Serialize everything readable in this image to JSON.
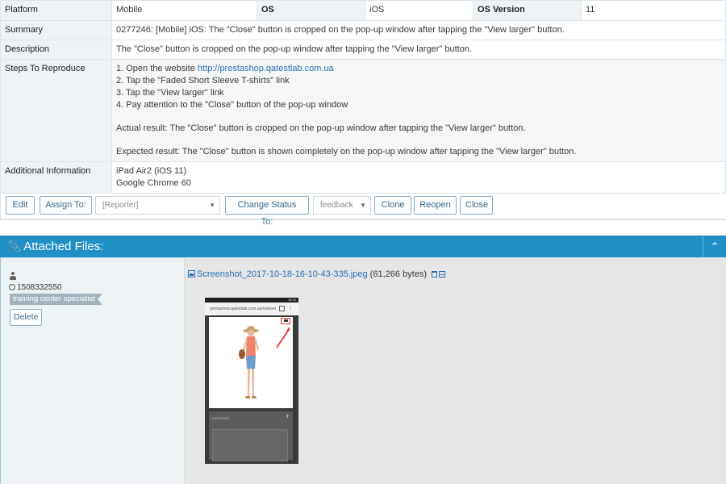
{
  "issue": {
    "platform_label": "Platform",
    "platform_value": "Mobile",
    "os_label": "OS",
    "os_value": "iOS",
    "os_version_label": "OS Version",
    "os_version_value": "11",
    "summary_label": "Summary",
    "summary_value": "0277246: [Mobile] iOS: The \"Close\" button is cropped on the pop-up window after tapping the \"View larger\" button.",
    "description_label": "Description",
    "description_value": "The \"Close\" button is cropped on the pop-up window after tapping the \"View larger\" button.",
    "steps_label": "Steps To Reproduce",
    "steps": {
      "step1_prefix": "1. Open the website ",
      "step1_link": "http://prestashop.qatestlab.com.ua",
      "step2": "2. Tap the \"Faded Short Sleeve T-shirts\" link",
      "step3": "3. Tap the \"View larger\" link",
      "step4": "4. Pay attention to the \"Close\" button of the pop-up window",
      "actual": "Actual result: The \"Close\" button is cropped on the pop-up window after tapping the \"View larger\" button.",
      "expected": "Expected result: The \"Close\" button is shown completely on the pop-up window after tapping the \"View larger\" button."
    },
    "additional_label": "Additional Information",
    "additional_line1": "iPad Air2 (iOS 11)",
    "additional_line2": "Google Chrome 60"
  },
  "actions": {
    "edit": "Edit",
    "assign_to": "Assign To:",
    "assign_select": "[Reporter]",
    "change_status": "Change Status To:",
    "status_select": "feedback",
    "clone": "Clone",
    "reopen": "Reopen",
    "close": "Close"
  },
  "attachments": {
    "header": "Attached Files:",
    "user_id": "1508332550",
    "role": "training center specialist",
    "delete": "Delete",
    "file_name": "Screenshot_2017-10-18-16-10-43-335.jpeg",
    "file_size": "(61,266 bytes)",
    "thumb": {
      "status_time": "16:10",
      "url": "prestashop.qatestlab.com.ua/ru/wom",
      "caption": "Faded Short Sleeve T-shirts",
      "section_label": "MAKEPOPE"
    }
  },
  "icons": {
    "attach": "paperclip-icon",
    "collapse": "chevron-up-icon",
    "user": "user-icon",
    "clock": "clock-icon",
    "image": "image-icon",
    "trash": "trash-icon",
    "minus": "collapse-minus-icon"
  },
  "colors": {
    "header_blue": "#2090c6",
    "link_blue": "#2a6fb4",
    "label_bg": "#edf3f4",
    "attach_bg": "#e6e6e6"
  }
}
